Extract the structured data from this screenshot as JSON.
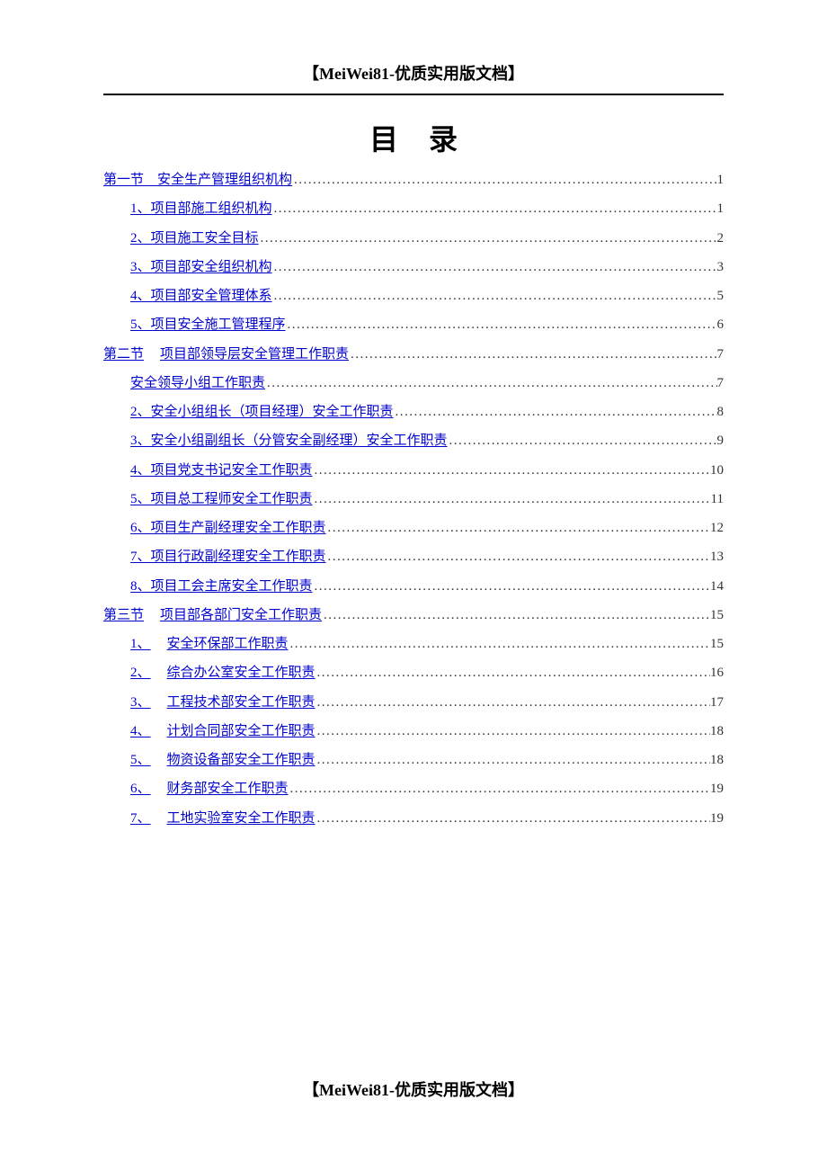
{
  "header": "【MeiWei81-优质实用版文档】",
  "toc_title": "目录",
  "footer": "【MeiWei81-优质实用版文档】",
  "toc": [
    {
      "level": 0,
      "marker": "第一节",
      "title": "安全生产管理组织机构",
      "page": "1",
      "marker_join": true
    },
    {
      "level": 1,
      "marker": "",
      "title": "1、项目部施工组织机构",
      "page": "1"
    },
    {
      "level": 1,
      "marker": "",
      "title": "2、项目施工安全目标",
      "page": "2"
    },
    {
      "level": 1,
      "marker": "",
      "title": "3、项目部安全组织机构",
      "page": "3"
    },
    {
      "level": 1,
      "marker": "",
      "title": "4、项目部安全管理体系",
      "page": "5"
    },
    {
      "level": 1,
      "marker": "",
      "title": "5、项目安全施工管理程序",
      "page": "6"
    },
    {
      "level": 0,
      "marker": "第二节",
      "title": "项目部领导层安全管理工作职责",
      "page": "7"
    },
    {
      "level": 1,
      "marker": "",
      "title": "安全领导小组工作职责",
      "page": "7"
    },
    {
      "level": 1,
      "marker": "",
      "title": "2、安全小组组长（项目经理）安全工作职责",
      "page": "8"
    },
    {
      "level": 1,
      "marker": "",
      "title": "3、安全小组副组长（分管安全副经理）安全工作职责",
      "page": "9"
    },
    {
      "level": 1,
      "marker": "",
      "title": "4、项目党支书记安全工作职责",
      "page": "10"
    },
    {
      "level": 1,
      "marker": "",
      "title": "5、项目总工程师安全工作职责",
      "page": "11"
    },
    {
      "level": 1,
      "marker": "",
      "title": "6、项目生产副经理安全工作职责",
      "page": "12"
    },
    {
      "level": 1,
      "marker": "",
      "title": "7、项目行政副经理安全工作职责",
      "page": "13"
    },
    {
      "level": 1,
      "marker": "",
      "title": "8、项目工会主席安全工作职责",
      "page": "14"
    },
    {
      "level": 0,
      "marker": "第三节",
      "title": "项目部各部门安全工作职责",
      "page": "15"
    },
    {
      "level": 1,
      "marker": "1、",
      "title": "安全环保部工作职责",
      "page": "15"
    },
    {
      "level": 1,
      "marker": "2、",
      "title": "综合办公室安全工作职责",
      "page": "16"
    },
    {
      "level": 1,
      "marker": "3、",
      "title": "工程技术部安全工作职责",
      "page": "17"
    },
    {
      "level": 1,
      "marker": "4、",
      "title": "计划合同部安全工作职责",
      "page": "18"
    },
    {
      "level": 1,
      "marker": "5、",
      "title": "物资设备部安全工作职责",
      "page": "18"
    },
    {
      "level": 1,
      "marker": "6、",
      "title": "财务部安全工作职责",
      "page": "19"
    },
    {
      "level": 1,
      "marker": "7、",
      "title": "工地实验室安全工作职责",
      "page": "19"
    }
  ]
}
